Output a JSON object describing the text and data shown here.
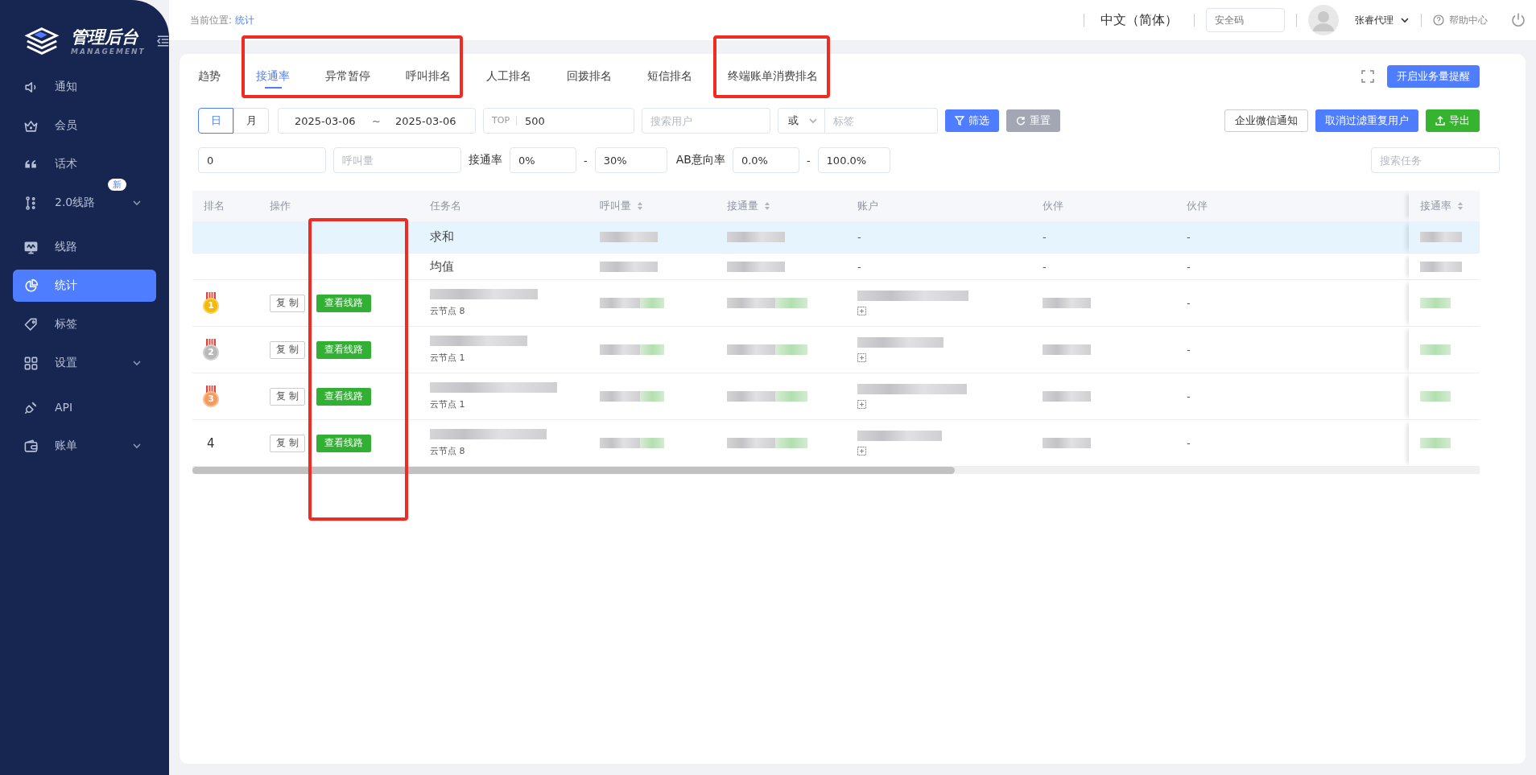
{
  "sidebar": {
    "logo_title": "管理后台",
    "logo_subtitle": "MANAGEMENT",
    "items": [
      {
        "label": "通知",
        "selected": false,
        "expandable": false
      },
      {
        "label": "会员",
        "selected": false,
        "expandable": false
      },
      {
        "label": "话术",
        "selected": false,
        "expandable": false
      },
      {
        "label": "2.0线路",
        "selected": false,
        "expandable": true,
        "badge": "新"
      },
      {
        "label": "线路",
        "selected": false,
        "expandable": false
      },
      {
        "label": "统计",
        "selected": true,
        "expandable": false
      },
      {
        "label": "标签",
        "selected": false,
        "expandable": false
      },
      {
        "label": "设置",
        "selected": false,
        "expandable": true
      },
      {
        "label": "API",
        "selected": false,
        "expandable": false
      },
      {
        "label": "账单",
        "selected": false,
        "expandable": true
      }
    ]
  },
  "header": {
    "breadcrumb_label": "当前位置:",
    "breadcrumb_current": "统计",
    "language": "中文（简体）",
    "security_code": {
      "placeholder": "安全码"
    },
    "user": "张睿代理",
    "help": "帮助中心"
  },
  "tabs": [
    {
      "label": "趋势",
      "selected": false,
      "highlighted": false
    },
    {
      "label": "接通率",
      "selected": true,
      "highlighted": true
    },
    {
      "label": "异常暂停",
      "selected": false,
      "highlighted": true
    },
    {
      "label": "呼叫排名",
      "selected": false,
      "highlighted": true
    },
    {
      "label": "人工排名",
      "selected": false,
      "highlighted": false
    },
    {
      "label": "回拨排名",
      "selected": false,
      "highlighted": false
    },
    {
      "label": "短信排名",
      "selected": false,
      "highlighted": false
    },
    {
      "label": "终端账单消费排名",
      "selected": false,
      "highlighted": true
    }
  ],
  "alert_button": "开启业务量提醒",
  "filters": {
    "period": [
      {
        "label": "日",
        "selected": true
      },
      {
        "label": "月",
        "selected": false
      }
    ],
    "date_from": "2025-03-06",
    "date_sep": "~",
    "date_to": "2025-03-06",
    "top": {
      "label": "TOP",
      "value": "500"
    },
    "user_search": {
      "placeholder": "搜索用户"
    },
    "logic": {
      "value": "或"
    },
    "tag": {
      "placeholder": "标签"
    },
    "filter_button": "筛选",
    "reset_button": "重置",
    "wechat_button": "企业微信通知",
    "dedupe_button": "取消过滤重复用户",
    "export_button": "导出",
    "min_value": {
      "value": "0"
    },
    "calls": {
      "placeholder": "呼叫量"
    },
    "rate_label": "接通率",
    "rate_from": {
      "value": "0%"
    },
    "rate_sep": "-",
    "rate_to": {
      "value": "30%"
    },
    "ab_label": "AB意向率",
    "ab_from": {
      "value": "0.0%"
    },
    "ab_sep": "-",
    "ab_to": {
      "value": "100.0%"
    },
    "task_search": {
      "placeholder": "搜索任务"
    }
  },
  "table": {
    "columns": [
      {
        "label": "排名",
        "sortable": false,
        "highlighted": false
      },
      {
        "label": "操作",
        "sortable": false,
        "highlighted": true
      },
      {
        "label": "任务名",
        "sortable": false,
        "highlighted": false
      },
      {
        "label": "呼叫量",
        "sortable": true,
        "highlighted": false
      },
      {
        "label": "接通量",
        "sortable": true,
        "highlighted": false
      },
      {
        "label": "账户",
        "sortable": false,
        "highlighted": false
      },
      {
        "label": "伙伴",
        "sortable": false,
        "highlighted": false
      },
      {
        "label": "伙伴",
        "sortable": false,
        "highlighted": false
      },
      {
        "label": "接通率",
        "sortable": true,
        "highlighted": false
      }
    ],
    "rows": [
      {
        "kind": "summary",
        "highlighted": true,
        "label": "求和",
        "account": "-",
        "partner": "-",
        "partner_2": "-"
      },
      {
        "kind": "summary",
        "highlighted": false,
        "label": "均值",
        "account": "-",
        "partner": "-",
        "partner_2": "-"
      },
      {
        "kind": "ranked",
        "rank": {
          "text": "1",
          "kind": "medal",
          "color": "#f5b90a"
        },
        "actions": [
          "复制",
          "查看线路"
        ],
        "node": "云节点 8",
        "account_expandable": true,
        "partner_2": "-"
      },
      {
        "kind": "ranked",
        "rank": {
          "text": "2",
          "kind": "medal",
          "color": "#b9b9b9"
        },
        "actions": [
          "复制",
          "查看线路"
        ],
        "node": "云节点 1",
        "account_expandable": true,
        "partner_2": "-"
      },
      {
        "kind": "ranked",
        "rank": {
          "text": "3",
          "kind": "medal",
          "color": "#f59a5c"
        },
        "actions": [
          "复制",
          "查看线路"
        ],
        "node": "云节点 1",
        "account_expandable": true,
        "partner_2": "-"
      },
      {
        "kind": "ranked",
        "rank": {
          "text": "4",
          "kind": "plain"
        },
        "actions": [
          "复制",
          "查看线路"
        ],
        "node": "云节点 8",
        "account_expandable": true,
        "partner_2": "-"
      }
    ]
  }
}
